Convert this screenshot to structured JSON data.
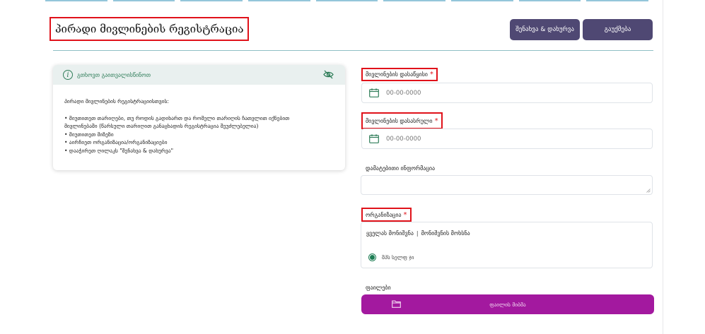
{
  "header": {
    "title": "პირადი მივლინების რეგისტრაცია",
    "save_close_label": "შენახვა & დახურვა",
    "cancel_label": "გაუქმება"
  },
  "top_tabs": [
    "",
    "",
    "",
    "",
    "",
    "",
    "",
    "",
    ""
  ],
  "info_card": {
    "title": "გთხოვთ გაითვალისწინოთ",
    "intro": "პირადი მივლინების რეგისტრაციისთვის:",
    "items": [
      "• მიუთითეთ თარიღები, თუ როდის გადიხართ და რომელი თარიღის ჩათვლით იქნებით\nმივლინებაში (წარსული თარიღით განაცხადის რეგისტრაცია შეუძლებელია)",
      "• მიუთითეთ მიზეზი",
      "• აირჩიეთ ორგანიზაცია/ორგანიზაციები",
      "• დააჭირეთ ღილაკს \"შენახვა & დახურვა\""
    ]
  },
  "form": {
    "start_label": "მივლინების დასაწყისი",
    "start_placeholder": "00-00-0000",
    "end_label": "მივლინების დასასრული",
    "end_placeholder": "00-00-0000",
    "extra_label": "დამატებითი ინფორმაცია",
    "org_label": "ორგანიზაცია",
    "org_select_all": "ყველას მონიშვნა",
    "org_deselect_all": "მონიშვნის მოხსნა",
    "org_option": "შპს სელფ ჯი",
    "required_mark": "*",
    "files_label": "ფაილები",
    "files_button": "ფაილის მიბმა"
  },
  "colors": {
    "primary_button": "#4f4873",
    "accent_green": "#2f7d59",
    "files_button": "#a3199f",
    "required": "#e0121a",
    "highlight_border": "#e0121a"
  },
  "icons": {
    "info": "info-icon",
    "hide": "eye-slash-icon",
    "calendar": "calendar-icon",
    "folder": "folder-icon"
  }
}
